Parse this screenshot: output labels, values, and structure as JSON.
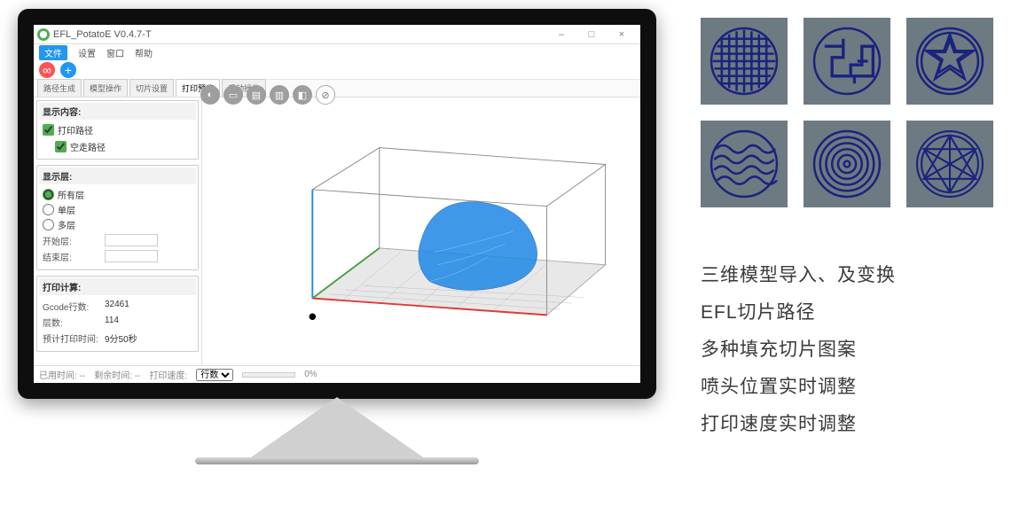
{
  "window": {
    "title": "EFL_PotatoE V0.4.7-T",
    "win_minimize": "–",
    "win_maximize": "□",
    "win_close": "×"
  },
  "menu": [
    "文件",
    "设置",
    "窗口",
    "帮助"
  ],
  "tabs": [
    "路径生成",
    "模型操作",
    "切片设置",
    "打印预览",
    "手动操作"
  ],
  "panels": {
    "display_content": {
      "title": "显示内容:",
      "cb1": "打印路径",
      "cb2": "空走路径"
    },
    "display_layer": {
      "title": "显示层:",
      "r1": "所有层",
      "r2": "单层",
      "r3": "多层",
      "start_label": "开始层:",
      "start_val": "",
      "end_label": "结束层:",
      "end_val": ""
    },
    "calc": {
      "title": "打印计算:",
      "k1": "Gcode行数:",
      "v1": "32461",
      "k2": "层数:",
      "v2": "114",
      "k3": "预计打印时间:",
      "v3": "9分50秒"
    }
  },
  "status": {
    "elapsed": "已用时间: -- ",
    "remain": "剩余时间: -- ",
    "speed": "打印速度:",
    "dropdown": "行数",
    "pct": "0%"
  },
  "features": [
    "三维模型导入、及变换",
    "EFL切片路径",
    "多种填充切片图案",
    "喷头位置实时调整",
    "打印速度实时调整"
  ]
}
